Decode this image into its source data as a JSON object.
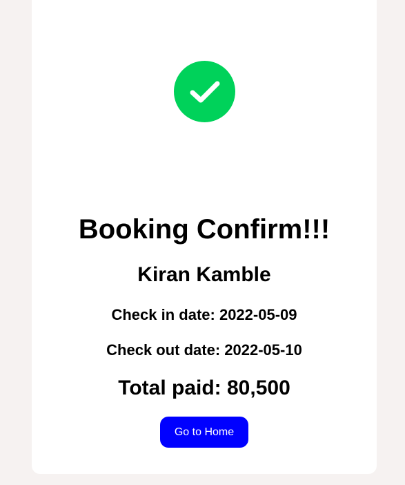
{
  "icon": {
    "name": "check-circle-icon",
    "color": "#00d25a"
  },
  "confirmation": {
    "title": "Booking Confirm!!!",
    "guest_name": "Kiran Kamble",
    "check_in": "Check in date: 2022-05-09",
    "check_out": "Check out date: 2022-05-10",
    "total_paid": "Total paid: 80,500"
  },
  "actions": {
    "home_label": "Go to Home",
    "home_color": "#0000ff"
  }
}
